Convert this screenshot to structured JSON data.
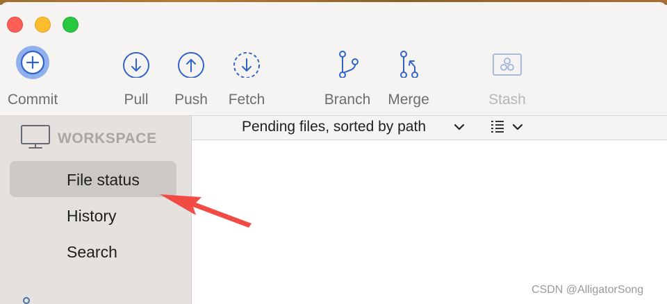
{
  "toolbar": {
    "commit": "Commit",
    "pull": "Pull",
    "push": "Push",
    "fetch": "Fetch",
    "branch": "Branch",
    "merge": "Merge",
    "stash": "Stash"
  },
  "sidebar": {
    "section": "WORKSPACE",
    "items": [
      {
        "label": "File status",
        "selected": true
      },
      {
        "label": "History",
        "selected": false
      },
      {
        "label": "Search",
        "selected": false
      }
    ]
  },
  "main": {
    "sort_label": "Pending files, sorted by path"
  },
  "watermark": "CSDN @AlligatorSong",
  "colors": {
    "accent": "#2f63c9",
    "annotation_arrow": "#f14b44"
  }
}
